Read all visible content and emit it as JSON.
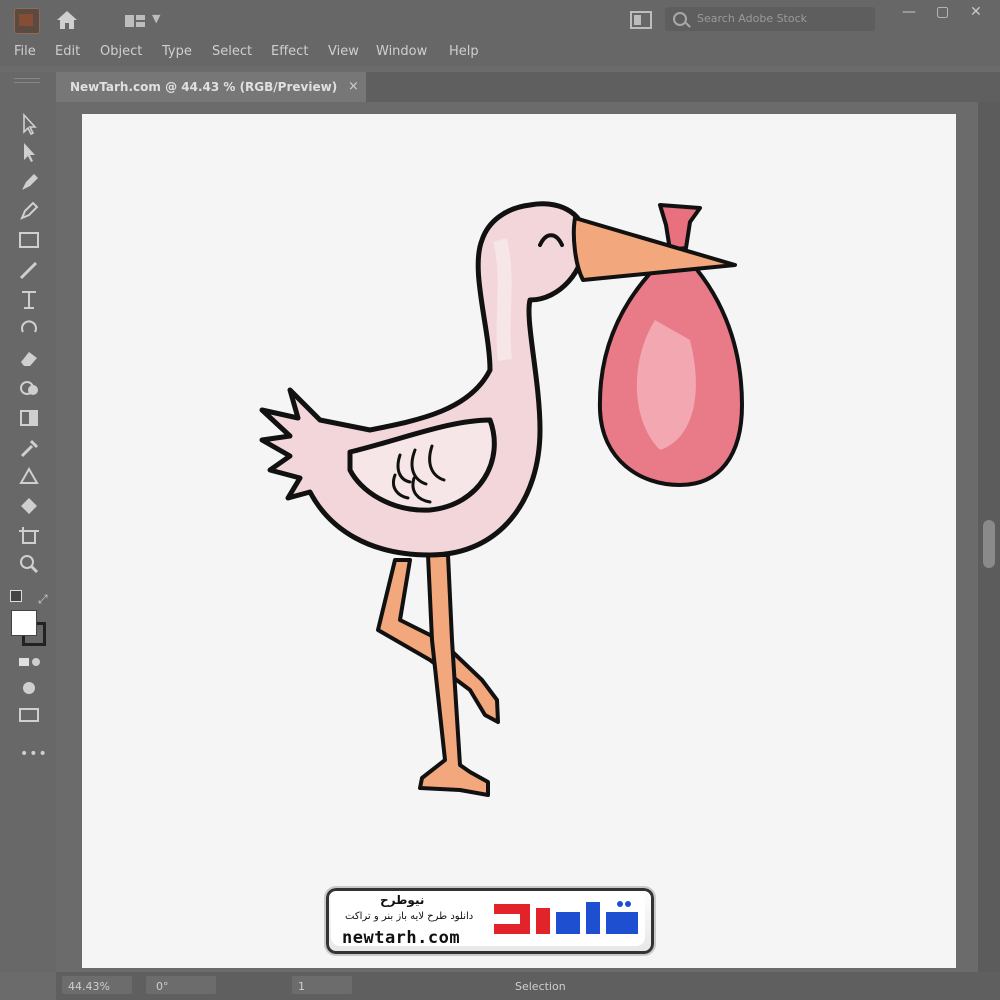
{
  "app": {
    "search_placeholder": "Search Adobe Stock",
    "window_controls": [
      "—",
      "▢",
      "✕"
    ]
  },
  "menu": [
    "File",
    "Edit",
    "Object",
    "Type",
    "Select",
    "Effect",
    "View",
    "Window",
    "Help"
  ],
  "document": {
    "tab_title": "NewTarh.com @ 44.43 % (RGB/Preview)",
    "close_symbol": "×"
  },
  "status": {
    "zoom": "44.43%",
    "rotation": "0°",
    "artboard_nav": "1",
    "mode": "Selection"
  },
  "watermark": {
    "name": "نیوطرح",
    "tagline": "دانلود طرح لایه باز بنر و تراکت",
    "url": "newtarh.com",
    "logo_text": "نیوطرح",
    "colors": {
      "logo_blue": "#1f4fd1",
      "logo_red": "#e2232a"
    }
  },
  "colors": {
    "ui_bg": "#676767",
    "artboard": "#f5f5f5",
    "stork_body": "#f3d2d6",
    "beak": "#f2a77d",
    "bundle": "#e8707f"
  }
}
